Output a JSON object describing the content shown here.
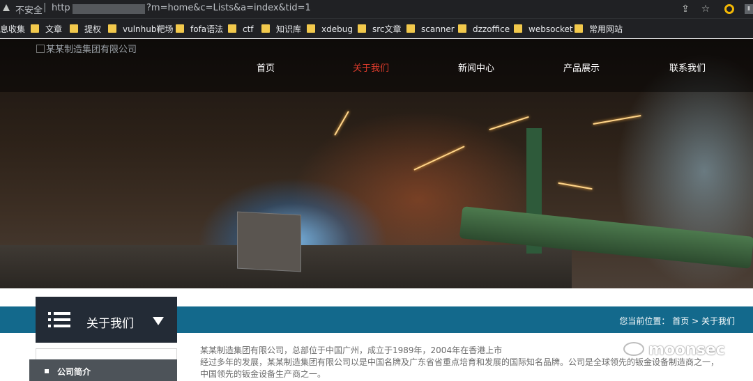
{
  "browser": {
    "insecure_label": "不安全",
    "separator": "|",
    "url_scheme": "http",
    "url_query": "?m=home&c=Lists&a=index&tid=1",
    "share_icon": "share-icon",
    "star_icon": "star-icon",
    "bookmarks": [
      {
        "label": "息收集",
        "has_folder": false
      },
      {
        "label": "文章"
      },
      {
        "label": "提权"
      },
      {
        "label": "vulnhub靶场"
      },
      {
        "label": "fofa语法"
      },
      {
        "label": "ctf"
      },
      {
        "label": "知识库"
      },
      {
        "label": "xdebug"
      },
      {
        "label": "src文章"
      },
      {
        "label": "scanner"
      },
      {
        "label": "dzzoffice"
      },
      {
        "label": "websocket"
      },
      {
        "label": "常用网站"
      }
    ]
  },
  "site": {
    "logo_alt": "某某制造集团有限公司",
    "nav": [
      {
        "label": "首页",
        "active": false
      },
      {
        "label": "关于我们",
        "active": true
      },
      {
        "label": "新闻中心",
        "active": false
      },
      {
        "label": "产品展示",
        "active": false
      },
      {
        "label": "联系我们",
        "active": false
      }
    ],
    "accent_color": "#13698c",
    "active_nav_color": "#e03c2c"
  },
  "category": {
    "icon": "list-icon",
    "title": "关于我们",
    "caret_icon": "caret-down-icon",
    "items": [
      {
        "label": "公司简介"
      }
    ]
  },
  "breadcrumb": {
    "prefix": "您当前位置：",
    "home": "首页",
    "separator": ">",
    "current": "关于我们"
  },
  "article": {
    "lines": [
      "某某制造集团有限公司，总部位于中国广州，成立于1989年，2004年在香港上市",
      "经过多年的发展，某某制造集团有限公司以是中国名牌及广东省省重点培育和发展的国际知名品牌。公司是全球领先的钣金设备制造商之一，",
      "中国领先的钣金设备生产商之一。"
    ]
  },
  "watermark": {
    "icon": "wechat-icon",
    "text": "moonsec"
  }
}
